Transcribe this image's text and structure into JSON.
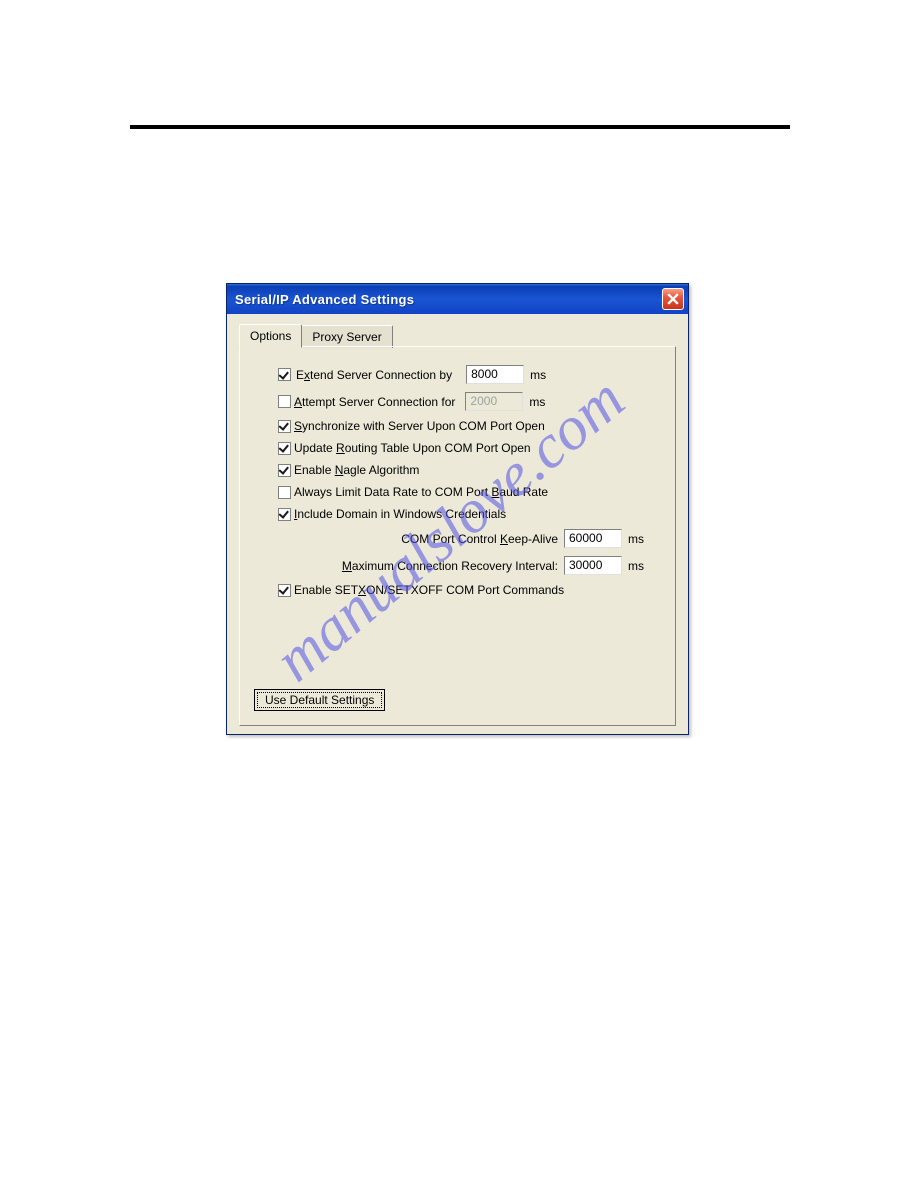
{
  "watermark": "manualslove.com",
  "dialog": {
    "title": "Serial/IP Advanced Settings",
    "tabs": {
      "options": "Options",
      "proxy": "Proxy Server"
    },
    "options": {
      "extend": {
        "checked": true,
        "label_pre": "E",
        "label_u": "x",
        "label_post": "tend Server Connection by",
        "value": "8000",
        "unit": "ms"
      },
      "attempt": {
        "checked": false,
        "label_u": "A",
        "label_post": "ttempt Server Connection for",
        "value": "2000",
        "unit": "ms"
      },
      "sync": {
        "checked": true,
        "label_u": "S",
        "label_post": "ynchronize with Server Upon COM Port Open"
      },
      "routing": {
        "checked": true,
        "label_pre": "Update ",
        "label_u": "R",
        "label_post": "outing Table Upon COM Port Open"
      },
      "nagle": {
        "checked": true,
        "label_pre": "Enable ",
        "label_u": "N",
        "label_post": "agle Algorithm"
      },
      "limit": {
        "checked": false,
        "label_pre": "Always Limit Data Rate to COM Port ",
        "label_u": "B",
        "label_post": "aud Rate"
      },
      "domain": {
        "checked": true,
        "label_u": "I",
        "label_post": "nclude Domain in Windows Credentials"
      },
      "keepalive": {
        "label_pre": "COM Port Control ",
        "label_u": "K",
        "label_post": "eep-Alive",
        "value": "60000",
        "unit": "ms"
      },
      "recovery": {
        "label_u": "M",
        "label_post": "aximum Connection Recovery Interval:",
        "value": "30000",
        "unit": "ms"
      },
      "setxon": {
        "checked": true,
        "label_pre": "Enable SET",
        "label_u": "X",
        "label_post": "ON/SETXOFF COM Port Commands"
      },
      "default_btn": "Use Default Settings"
    }
  }
}
